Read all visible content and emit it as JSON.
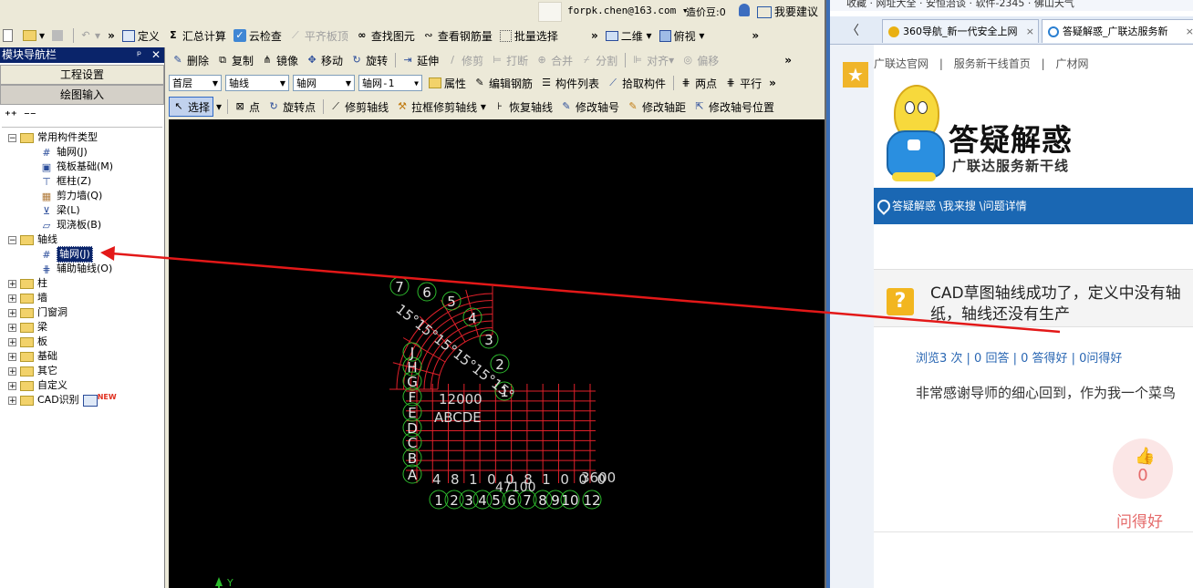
{
  "cad": {
    "titlebar": {
      "user_email": "forpk.chen@163.com",
      "coins_label": "造价豆:0",
      "feedback_label": "我要建议"
    },
    "toolbar1": {
      "define": "定义",
      "sum_calc": "汇总计算",
      "cloud_check": "云检查",
      "flush_slab": "平齐板顶",
      "find_element": "查找图元",
      "view_rebar": "查看钢筋量",
      "batch_select": "批量选择",
      "view_mode": "二维",
      "view_angle": "俯视"
    },
    "toolbar2": {
      "delete": "删除",
      "copy": "复制",
      "mirror": "镜像",
      "move": "移动",
      "rotate": "旋转",
      "extend": "延伸",
      "trim": "修剪",
      "break": "打断",
      "merge": "合并",
      "split": "分割",
      "align": "对齐",
      "offset": "偏移"
    },
    "toolbar3": {
      "floor": "首层",
      "category": "轴线",
      "type": "轴网",
      "instance": "轴网-1",
      "properties": "属性",
      "edit_rebar": "编辑钢筋",
      "component_list": "构件列表",
      "pick_component": "拾取构件",
      "two_points": "两点",
      "parallel": "平行"
    },
    "toolbar4": {
      "select": "选择",
      "point": "点",
      "rotate_point": "旋转点",
      "trim_axis": "修剪轴线",
      "box_trim_axis": "拉框修剪轴线",
      "restore_axis": "恢复轴线",
      "edit_axis_no": "修改轴号",
      "edit_axis_dist": "修改轴距",
      "edit_axis_pos": "修改轴号位置"
    },
    "nav": {
      "title": "模块导航栏",
      "project_settings": "工程设置",
      "drawing_input": "绘图输入",
      "tree": [
        {
          "label": "常用构件类型",
          "kind": "folder",
          "expanded": true
        },
        {
          "label": "轴网(J)",
          "kind": "leaf"
        },
        {
          "label": "筏板基础(M)",
          "kind": "leaf"
        },
        {
          "label": "框柱(Z)",
          "kind": "leaf"
        },
        {
          "label": "剪力墙(Q)",
          "kind": "leaf"
        },
        {
          "label": "梁(L)",
          "kind": "leaf"
        },
        {
          "label": "现浇板(B)",
          "kind": "leaf"
        },
        {
          "label": "轴线",
          "kind": "folder",
          "expanded": true
        },
        {
          "label": "轴网(J)",
          "kind": "leaf",
          "selected": true
        },
        {
          "label": "辅助轴线(O)",
          "kind": "leaf"
        },
        {
          "label": "柱",
          "kind": "folder"
        },
        {
          "label": "墙",
          "kind": "folder"
        },
        {
          "label": "门窗洞",
          "kind": "folder"
        },
        {
          "label": "梁",
          "kind": "folder"
        },
        {
          "label": "板",
          "kind": "folder"
        },
        {
          "label": "基础",
          "kind": "folder"
        },
        {
          "label": "其它",
          "kind": "folder"
        },
        {
          "label": "自定义",
          "kind": "folder"
        },
        {
          "label": "CAD识别",
          "kind": "folder"
        }
      ],
      "new_badge": "NEW"
    },
    "canvas": {
      "arc_labels": [
        "7",
        "6",
        "5",
        "4",
        "3",
        "2",
        "1"
      ],
      "bottom_labels": [
        "1",
        "2",
        "3",
        "4",
        "5",
        "6",
        "7",
        "8",
        "9",
        "10",
        "12"
      ],
      "left_labels": [
        "A",
        "B",
        "C",
        "D",
        "E",
        "F",
        "G",
        "H",
        "J"
      ],
      "dim_arc": "15°15°15°15°15°15°",
      "dim_bottom": "4810081000",
      "dim_bottom2": "47100",
      "dim_right": "3600",
      "dim_mid": "12000",
      "dim_letters": "ABCDE",
      "ucs_label": "Y"
    },
    "annotation_color": "#e31818"
  },
  "browser": {
    "bookmarks": "收藏 · 网址大全 · 安恒治谈 · 软件-2345 · 佛山天气",
    "tabs": [
      {
        "label": "360导航_新一代安全上网"
      },
      {
        "label": "答疑解惑_广联达服务新"
      }
    ],
    "site_links": [
      "广联达官网",
      "服务新干线首页",
      "广材网"
    ],
    "logo_title": "答疑解惑",
    "logo_subtitle": "广联达服务新干线",
    "breadcrumb": "答疑解惑 \\我来搜 \\问题详情",
    "question_title_line1": "CAD草图轴线成功了，定义中没有轴",
    "question_title_line2": "纸，轴线还没有生产",
    "stats": "浏览3 次 | 0 回答 | 0 答得好 | 0问得好",
    "body_text": "非常感谢导师的细心回到，作为我一个菜鸟",
    "like_count": "0",
    "like_label": "问得好",
    "accent_blue": "#1a67b3",
    "accent_pink": "#e56b6b"
  }
}
